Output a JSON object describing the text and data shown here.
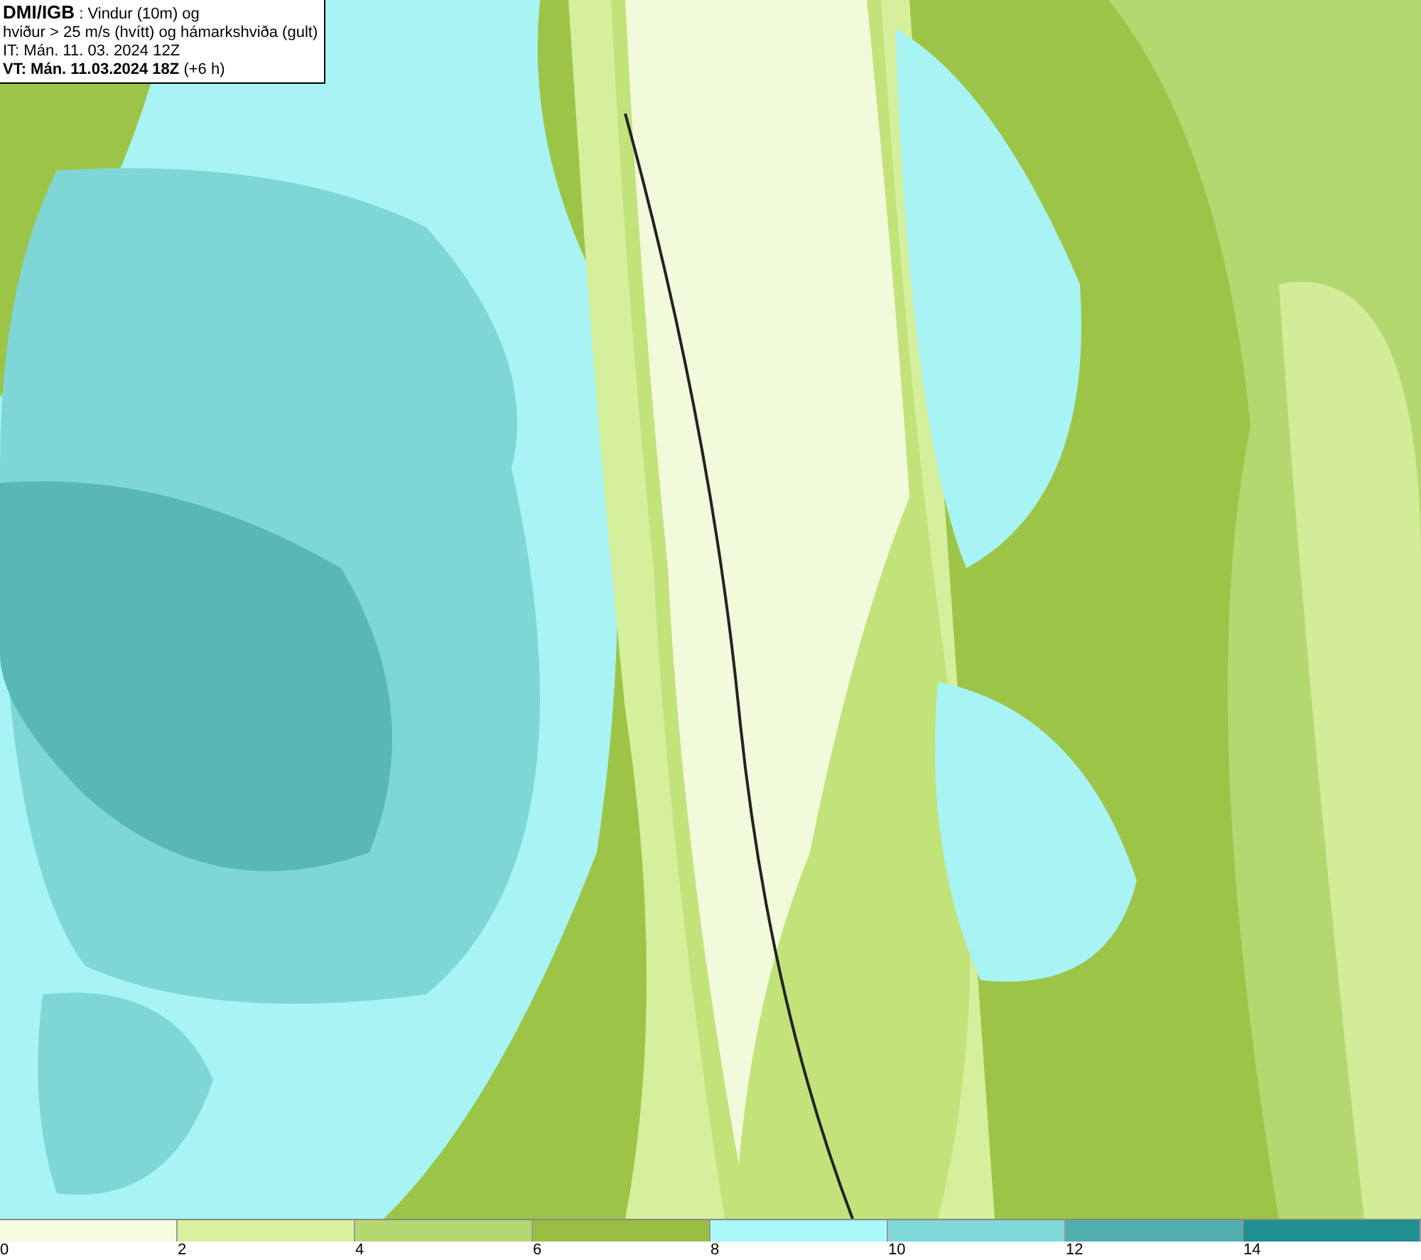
{
  "header": {
    "lines": [
      "**DMI/IGB** : Vindur (10m) og",
      "hviður > 25 m/s (hvítt) og hámarkshviða (gult)",
      "IT: Mán. 11. 03. 2024 12Z",
      "**VT: Mán. 11.03.2024 18Z** (+6 h)"
    ]
  },
  "legend": {
    "bins": [
      {
        "color": "#f4fce2"
      },
      {
        "color": "#d8f0a0"
      },
      {
        "color": "#b4d870"
      },
      {
        "color": "#98bf44"
      },
      {
        "color": "#a8f8f8"
      },
      {
        "color": "#80d8d8"
      },
      {
        "color": "#50b0b0"
      },
      {
        "color": "#209090"
      }
    ],
    "ticks": [
      "0",
      "2",
      "4",
      "6",
      "8",
      "10",
      "12",
      "14"
    ]
  }
}
